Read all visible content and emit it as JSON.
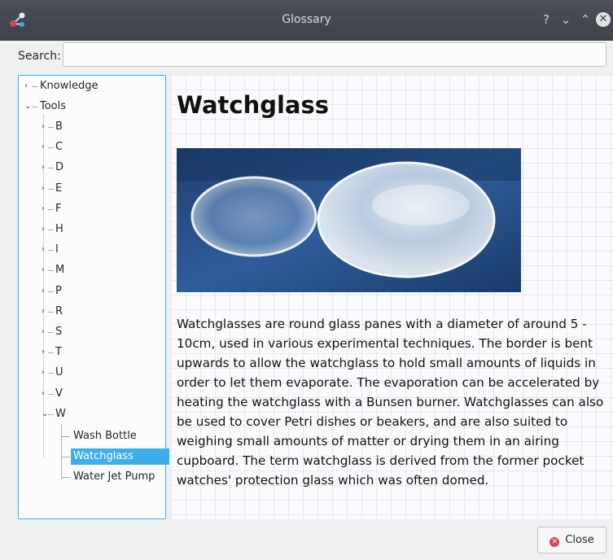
{
  "window": {
    "title": "Glossary",
    "app_icon": "kalzium-icon"
  },
  "titlebar": {
    "help": "?",
    "minimize": "⌄",
    "maximize": "⌃",
    "close": "✕"
  },
  "search": {
    "label": "Search:",
    "value": "",
    "placeholder": ""
  },
  "tree": {
    "top": [
      "Knowledge",
      "Tools"
    ],
    "letters": [
      "B",
      "C",
      "D",
      "E",
      "F",
      "H",
      "I",
      "M",
      "P",
      "R",
      "S",
      "T",
      "U",
      "V",
      "W"
    ],
    "w_children": [
      "Wash Bottle",
      "Watchglass",
      "Water Jet Pump"
    ],
    "selected": "Watchglass"
  },
  "article": {
    "title": "Watchglass",
    "image_alt": "watchglass photo",
    "text": "Watchglasses are round glass panes with a diameter of around 5 - 10cm, used in various experimental techniques. The border is bent upwards to allow the watchglass to hold small amounts of liquids in order to let them evaporate. The evaporation can be accelerated by heating the watchglass with a Bunsen burner. Watchglasses can also be used to cover Petri dishes or beakers, and are also suited to weighing small amounts of matter or drying them in an airing cupboard. The term watchglass is derived from the former pocket watches' protection glass which was often domed."
  },
  "footer": {
    "close_label": "Close"
  },
  "colors": {
    "selection": "#3daee9",
    "titlebar": "#43494f",
    "close_icon": "#da4453"
  }
}
